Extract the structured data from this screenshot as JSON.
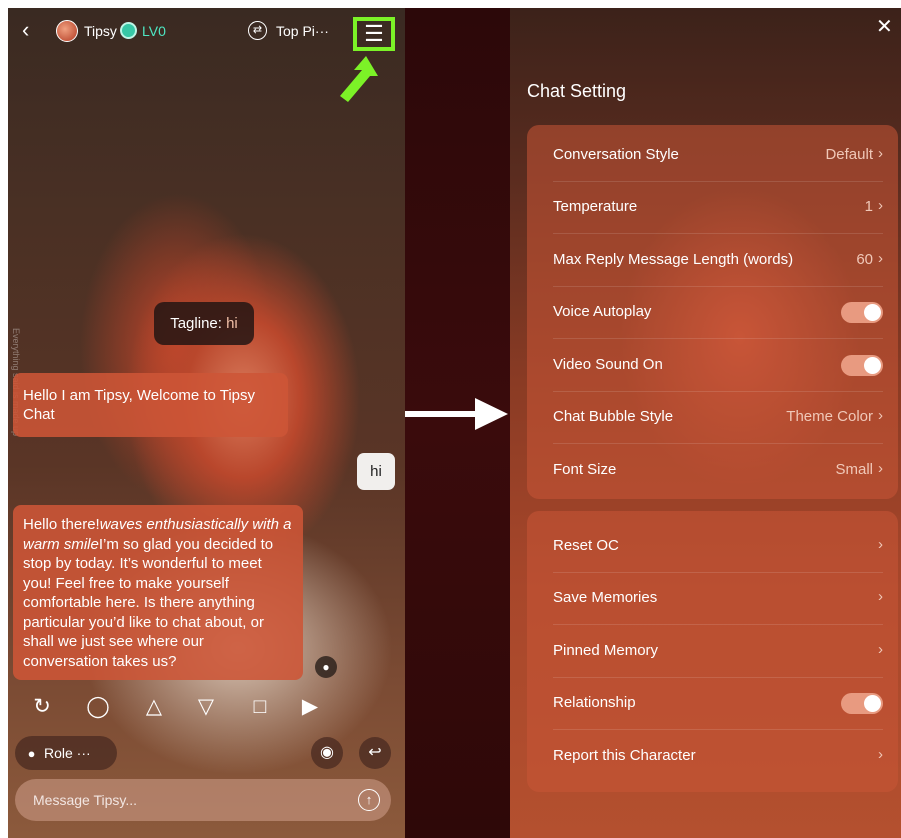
{
  "left": {
    "header": {
      "back_icon": "chevron-left-icon",
      "character_name": "Tipsy",
      "level": "LV0",
      "top_label": "Top Pi···",
      "menu_icon": "hamburger-menu-icon"
    },
    "tagline": {
      "prefix": "Tagline:",
      "value": "hi"
    },
    "messages": {
      "greeting": "Hello I am Tipsy, Welcome to Tipsy Chat",
      "user_message": "hi",
      "reply_start": "Hello there!",
      "reply_italic": "waves enthusiastically with a warm smile",
      "reply_end": "I’m so glad you decided to stop by today. It’s wonderful to meet you! Feel free to make yourself comfortable here. Is there anything particular you’d like to chat about, or shall we just see where our conversation takes us?"
    },
    "actions": [
      "refresh-icon",
      "new-chat-icon",
      "thumbs-up-icon",
      "thumbs-down-icon",
      "image-add-icon",
      "video-add-icon"
    ],
    "role_label": "Role ···",
    "input": {
      "placeholder": "Message Tipsy..."
    },
    "watermark": "Everything said is made up"
  },
  "settings": {
    "title": "Chat Setting",
    "group1": [
      {
        "label": "Conversation Style",
        "value": "Default",
        "kind": "link"
      },
      {
        "label": "Temperature",
        "value": "1",
        "kind": "link"
      },
      {
        "label": "Max Reply Message Length (words)",
        "value": "60",
        "kind": "link"
      },
      {
        "label": "Voice Autoplay",
        "kind": "toggle",
        "on": true
      },
      {
        "label": "Video Sound On",
        "kind": "toggle",
        "on": true
      },
      {
        "label": "Chat Bubble Style",
        "value": "Theme Color",
        "kind": "link"
      },
      {
        "label": "Font Size",
        "value": "Small",
        "kind": "link"
      }
    ],
    "group2": [
      {
        "label": "Reset OC",
        "kind": "link"
      },
      {
        "label": "Save Memories",
        "kind": "link"
      },
      {
        "label": "Pinned Memory",
        "kind": "link"
      },
      {
        "label": "Relationship",
        "kind": "toggle",
        "on": true
      },
      {
        "label": "Report this Character",
        "kind": "link"
      }
    ]
  },
  "colors": {
    "highlight": "#7cf227",
    "accent_bubble": "#cd5537",
    "level": "#4ee6c2"
  }
}
